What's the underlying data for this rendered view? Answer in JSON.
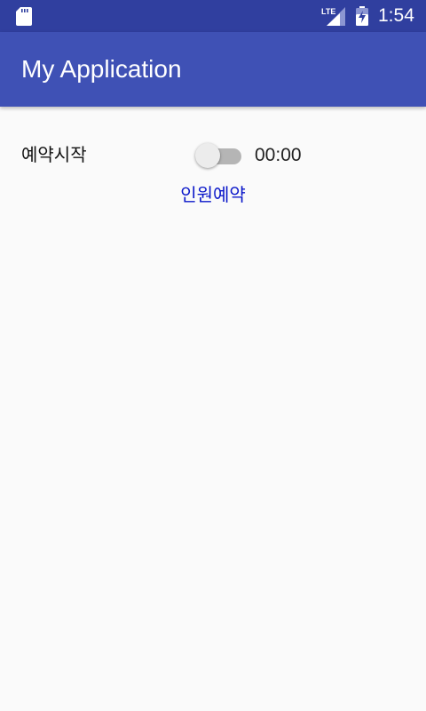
{
  "status_bar": {
    "time": "1:54",
    "icons": {
      "left": "sd-card-icon",
      "network": "lte-signal-icon",
      "battery": "battery-charging-icon"
    },
    "network_label": "LTE"
  },
  "app_bar": {
    "title": "My Application"
  },
  "content": {
    "reserve_label": "예약시작",
    "reserve_switch": {
      "checked": false
    },
    "time_value": "00:00",
    "group_reserve_label": "인원예약"
  },
  "colors": {
    "status_bar": "#303f9f",
    "app_bar": "#3f51b5",
    "background": "#fafafa",
    "link": "#0a17c9"
  }
}
